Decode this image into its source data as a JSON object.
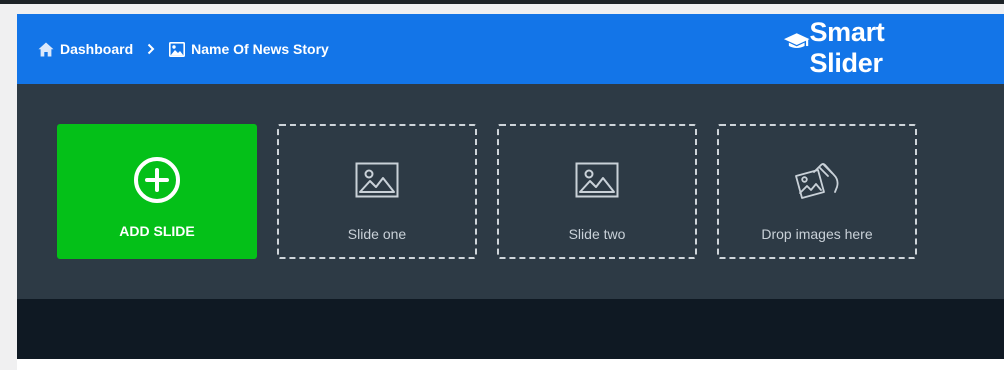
{
  "breadcrumb": {
    "dashboard_label": "Dashboard",
    "current_label": "Name Of News Story"
  },
  "logo": {
    "text": "Smart Slider"
  },
  "slides": {
    "add_label": "ADD SLIDE",
    "items": [
      {
        "label": "Slide one",
        "icon": "image-icon"
      },
      {
        "label": "Slide two",
        "icon": "image-icon"
      }
    ],
    "drop_label": "Drop images here",
    "drop_icon": "hand-photo-icon"
  },
  "colors": {
    "header": "#1375e8",
    "stage": "#2d3a45",
    "footer_strip": "#0f1923",
    "add_button": "#04c018"
  }
}
